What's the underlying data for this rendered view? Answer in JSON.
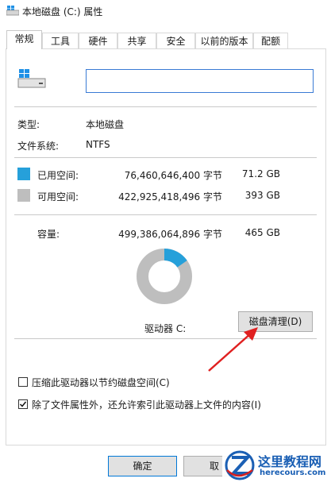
{
  "window": {
    "title": "本地磁盘 (C:) 属性"
  },
  "tabs": [
    {
      "label": "常规",
      "active": true
    },
    {
      "label": "工具"
    },
    {
      "label": "硬件"
    },
    {
      "label": "共享"
    },
    {
      "label": "安全"
    },
    {
      "label": "以前的版本"
    },
    {
      "label": "配额"
    }
  ],
  "drive_name_value": "",
  "info": {
    "type_label": "类型:",
    "type_value": "本地磁盘",
    "fs_label": "文件系统:",
    "fs_value": "NTFS"
  },
  "space": {
    "used_label": "已用空间:",
    "used_bytes": "76,460,646,400 字节",
    "used_size": "71.2 GB",
    "free_label": "可用空间:",
    "free_bytes": "422,925,418,496 字节",
    "free_size": "393 GB",
    "capacity_label": "容量:",
    "capacity_bytes": "499,386,064,896 字节",
    "capacity_size": "465 GB",
    "used_fraction": 0.153
  },
  "colors": {
    "used": "#26a0da",
    "free": "#bebebe",
    "arrow": "#e02020"
  },
  "drive_label": "驱动器 C:",
  "cleanup_button": "磁盘清理(D)",
  "options": {
    "compress_label": "压缩此驱动器以节约磁盘空间(C)",
    "compress_checked": false,
    "index_label": "除了文件属性外，还允许索引此驱动器上文件的内容(I)",
    "index_checked": true
  },
  "buttons": {
    "ok": "确定",
    "cancel": "取"
  },
  "watermark": {
    "brand": "这里教程网",
    "site": "herecours.com"
  }
}
